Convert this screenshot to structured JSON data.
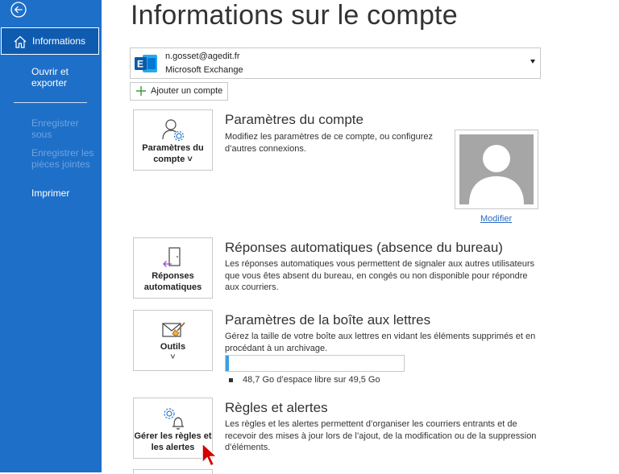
{
  "sidebar": {
    "active_item": "Informations",
    "items": [
      {
        "label": "Ouvrir et exporter",
        "disabled": false
      },
      {
        "label": "Enregistrer sous",
        "disabled": true
      },
      {
        "label": "Enregistrer les pièces jointes",
        "disabled": true
      },
      {
        "label": "Imprimer",
        "disabled": false
      }
    ]
  },
  "header": {
    "title": "Informations sur le compte"
  },
  "account": {
    "email": "n.gosset@agedit.fr",
    "type": "Microsoft Exchange",
    "add_account_label": "Ajouter un compte"
  },
  "sections": {
    "account_settings": {
      "tile_label": "Paramètres du compte ˅",
      "title": "Paramètres du compte",
      "description": "Modifiez les paramètres de ce compte, ou configurez d’autres connexions.",
      "modify_link": "Modifier"
    },
    "auto_replies": {
      "tile_label": "Réponses automatiques",
      "title": "Réponses automatiques (absence du bureau)",
      "description": "Les réponses automatiques vous permettent de signaler aux autres utilisateurs que vous êtes absent du bureau, en congés ou non disponible pour répondre aux courriers."
    },
    "mailbox_settings": {
      "tile_label": "Outils",
      "tile_caret": "˅",
      "title": "Paramètres de la boîte aux lettres",
      "description": "Gérez la taille de votre boîte aux lettres en vidant les éléments supprimés et en procédant à un archivage.",
      "quota_text": "48,7 Go d’espace libre sur 49,5 Go",
      "quota_used_fraction": 0.016
    },
    "rules_alerts": {
      "tile_label": "Gérer les règles et les alertes",
      "title": "Règles et alertes",
      "description": "Les règles et les alertes permettent d’organiser les courriers entrants et de recevoir des mises à jour lors de l’ajout, de la modification ou de la suppression d’éléments."
    }
  },
  "colors": {
    "sidebar_bg": "#1e6fc8",
    "accent": "#2b6cc4",
    "quota_fill": "#3aa0e0",
    "cursor": "#d40000"
  },
  "icons": {
    "back": "back-arrow-icon",
    "home": "home-icon",
    "exchange": "exchange-icon",
    "plus": "plus-icon",
    "account_settings": "user-gear-icon",
    "auto_replies": "door-arrow-icon",
    "tools": "mail-broom-icon",
    "rules": "gear-bell-icon",
    "avatar": "avatar-placeholder-icon",
    "cursor": "mouse-pointer-icon"
  }
}
